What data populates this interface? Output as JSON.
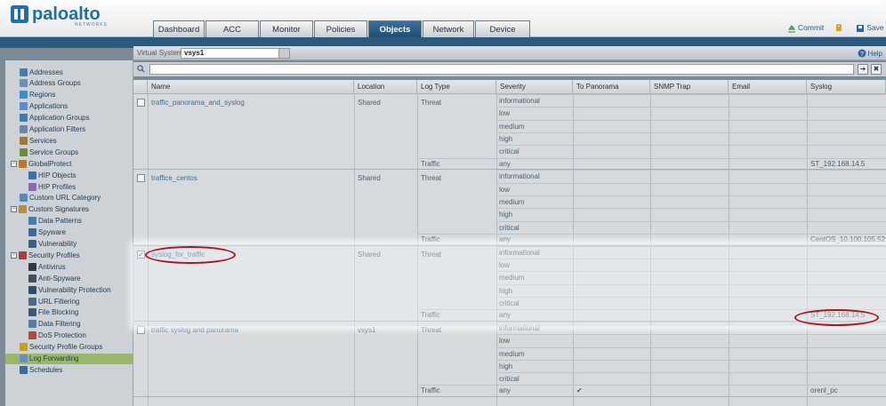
{
  "brand": {
    "name": "paloalto",
    "sub": "NETWORKS"
  },
  "tabs": [
    "Dashboard",
    "ACC",
    "Monitor",
    "Policies",
    "Objects",
    "Network",
    "Device"
  ],
  "active_tab": "Objects",
  "header_actions": {
    "commit": "Commit",
    "save": "Save"
  },
  "vsys": {
    "label": "Virtual System",
    "value": "vsys1"
  },
  "help": "Help",
  "sidebar": [
    {
      "label": "Addresses",
      "level": 0
    },
    {
      "label": "Address Groups",
      "level": 0
    },
    {
      "label": "Regions",
      "level": 0
    },
    {
      "label": "Applications",
      "level": 0
    },
    {
      "label": "Application Groups",
      "level": 0
    },
    {
      "label": "Application Filters",
      "level": 0
    },
    {
      "label": "Services",
      "level": 0
    },
    {
      "label": "Service Groups",
      "level": 0
    },
    {
      "label": "GlobalProtect",
      "level": 0,
      "tree": true
    },
    {
      "label": "HIP Objects",
      "level": 1
    },
    {
      "label": "HIP Profiles",
      "level": 1
    },
    {
      "label": "Custom URL Category",
      "level": 0
    },
    {
      "label": "Custom Signatures",
      "level": 0,
      "tree": true
    },
    {
      "label": "Data Patterns",
      "level": 1
    },
    {
      "label": "Spyware",
      "level": 1
    },
    {
      "label": "Vulnerability",
      "level": 1
    },
    {
      "label": "Security Profiles",
      "level": 0,
      "tree": true
    },
    {
      "label": "Antivirus",
      "level": 1
    },
    {
      "label": "Anti-Spyware",
      "level": 1
    },
    {
      "label": "Vulnerability Protection",
      "level": 1
    },
    {
      "label": "URL Filtering",
      "level": 1
    },
    {
      "label": "File Blocking",
      "level": 1
    },
    {
      "label": "Data Filtering",
      "level": 1
    },
    {
      "label": "DoS Protection",
      "level": 1
    },
    {
      "label": "Security Profile Groups",
      "level": 0
    },
    {
      "label": "Log Forwarding",
      "level": 0,
      "selected": true
    },
    {
      "label": "Schedules",
      "level": 0
    }
  ],
  "columns": [
    "Name",
    "Location",
    "Log Type",
    "Severity",
    "To Panorama",
    "SNMP Trap",
    "Email",
    "Syslog"
  ],
  "severities": [
    "informational",
    "low",
    "medium",
    "high",
    "critical"
  ],
  "rows": [
    {
      "name": "traffic_panorama_and_syslog",
      "location": "Shared",
      "threat": "Threat",
      "traffic": "Traffic",
      "any": "any",
      "panorama_mark": "",
      "syslog": "ST_192.168.14.5",
      "checked": false
    },
    {
      "name": "traffice_centos",
      "location": "Shared",
      "threat": "Threat",
      "traffic": "Traffic",
      "any": "any",
      "panorama_mark": "",
      "syslog": "CentOS_10.100.105.52",
      "checked": false
    },
    {
      "name": "syslog_for_traffic",
      "location": "Shared",
      "threat": "Threat",
      "traffic": "Traffic",
      "any": "any",
      "panorama_mark": "",
      "syslog": "ST_192.168.14.5",
      "checked": true
    },
    {
      "name": "traffic syslog and panorama",
      "location": "vsys1",
      "threat": "Threat",
      "traffic": "Traffic",
      "any": "any",
      "panorama_mark": "✔",
      "syslog": "orenl_pc",
      "checked": false
    }
  ]
}
